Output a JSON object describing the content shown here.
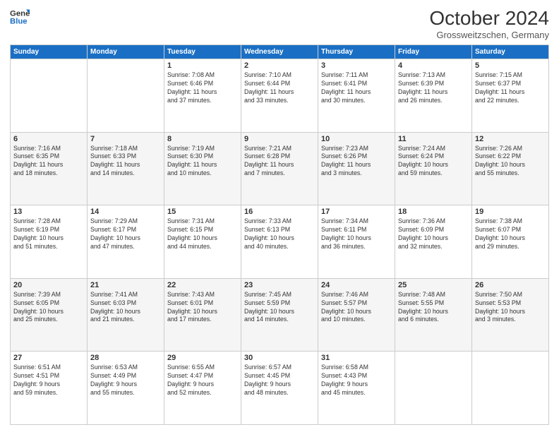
{
  "header": {
    "logo_line1": "General",
    "logo_line2": "Blue",
    "title": "October 2024",
    "subtitle": "Grossweitzschen, Germany"
  },
  "days_of_week": [
    "Sunday",
    "Monday",
    "Tuesday",
    "Wednesday",
    "Thursday",
    "Friday",
    "Saturday"
  ],
  "weeks": [
    [
      {
        "day": "",
        "info": ""
      },
      {
        "day": "",
        "info": ""
      },
      {
        "day": "1",
        "info": "Sunrise: 7:08 AM\nSunset: 6:46 PM\nDaylight: 11 hours\nand 37 minutes."
      },
      {
        "day": "2",
        "info": "Sunrise: 7:10 AM\nSunset: 6:44 PM\nDaylight: 11 hours\nand 33 minutes."
      },
      {
        "day": "3",
        "info": "Sunrise: 7:11 AM\nSunset: 6:41 PM\nDaylight: 11 hours\nand 30 minutes."
      },
      {
        "day": "4",
        "info": "Sunrise: 7:13 AM\nSunset: 6:39 PM\nDaylight: 11 hours\nand 26 minutes."
      },
      {
        "day": "5",
        "info": "Sunrise: 7:15 AM\nSunset: 6:37 PM\nDaylight: 11 hours\nand 22 minutes."
      }
    ],
    [
      {
        "day": "6",
        "info": "Sunrise: 7:16 AM\nSunset: 6:35 PM\nDaylight: 11 hours\nand 18 minutes."
      },
      {
        "day": "7",
        "info": "Sunrise: 7:18 AM\nSunset: 6:33 PM\nDaylight: 11 hours\nand 14 minutes."
      },
      {
        "day": "8",
        "info": "Sunrise: 7:19 AM\nSunset: 6:30 PM\nDaylight: 11 hours\nand 10 minutes."
      },
      {
        "day": "9",
        "info": "Sunrise: 7:21 AM\nSunset: 6:28 PM\nDaylight: 11 hours\nand 7 minutes."
      },
      {
        "day": "10",
        "info": "Sunrise: 7:23 AM\nSunset: 6:26 PM\nDaylight: 11 hours\nand 3 minutes."
      },
      {
        "day": "11",
        "info": "Sunrise: 7:24 AM\nSunset: 6:24 PM\nDaylight: 10 hours\nand 59 minutes."
      },
      {
        "day": "12",
        "info": "Sunrise: 7:26 AM\nSunset: 6:22 PM\nDaylight: 10 hours\nand 55 minutes."
      }
    ],
    [
      {
        "day": "13",
        "info": "Sunrise: 7:28 AM\nSunset: 6:19 PM\nDaylight: 10 hours\nand 51 minutes."
      },
      {
        "day": "14",
        "info": "Sunrise: 7:29 AM\nSunset: 6:17 PM\nDaylight: 10 hours\nand 47 minutes."
      },
      {
        "day": "15",
        "info": "Sunrise: 7:31 AM\nSunset: 6:15 PM\nDaylight: 10 hours\nand 44 minutes."
      },
      {
        "day": "16",
        "info": "Sunrise: 7:33 AM\nSunset: 6:13 PM\nDaylight: 10 hours\nand 40 minutes."
      },
      {
        "day": "17",
        "info": "Sunrise: 7:34 AM\nSunset: 6:11 PM\nDaylight: 10 hours\nand 36 minutes."
      },
      {
        "day": "18",
        "info": "Sunrise: 7:36 AM\nSunset: 6:09 PM\nDaylight: 10 hours\nand 32 minutes."
      },
      {
        "day": "19",
        "info": "Sunrise: 7:38 AM\nSunset: 6:07 PM\nDaylight: 10 hours\nand 29 minutes."
      }
    ],
    [
      {
        "day": "20",
        "info": "Sunrise: 7:39 AM\nSunset: 6:05 PM\nDaylight: 10 hours\nand 25 minutes."
      },
      {
        "day": "21",
        "info": "Sunrise: 7:41 AM\nSunset: 6:03 PM\nDaylight: 10 hours\nand 21 minutes."
      },
      {
        "day": "22",
        "info": "Sunrise: 7:43 AM\nSunset: 6:01 PM\nDaylight: 10 hours\nand 17 minutes."
      },
      {
        "day": "23",
        "info": "Sunrise: 7:45 AM\nSunset: 5:59 PM\nDaylight: 10 hours\nand 14 minutes."
      },
      {
        "day": "24",
        "info": "Sunrise: 7:46 AM\nSunset: 5:57 PM\nDaylight: 10 hours\nand 10 minutes."
      },
      {
        "day": "25",
        "info": "Sunrise: 7:48 AM\nSunset: 5:55 PM\nDaylight: 10 hours\nand 6 minutes."
      },
      {
        "day": "26",
        "info": "Sunrise: 7:50 AM\nSunset: 5:53 PM\nDaylight: 10 hours\nand 3 minutes."
      }
    ],
    [
      {
        "day": "27",
        "info": "Sunrise: 6:51 AM\nSunset: 4:51 PM\nDaylight: 9 hours\nand 59 minutes."
      },
      {
        "day": "28",
        "info": "Sunrise: 6:53 AM\nSunset: 4:49 PM\nDaylight: 9 hours\nand 55 minutes."
      },
      {
        "day": "29",
        "info": "Sunrise: 6:55 AM\nSunset: 4:47 PM\nDaylight: 9 hours\nand 52 minutes."
      },
      {
        "day": "30",
        "info": "Sunrise: 6:57 AM\nSunset: 4:45 PM\nDaylight: 9 hours\nand 48 minutes."
      },
      {
        "day": "31",
        "info": "Sunrise: 6:58 AM\nSunset: 4:43 PM\nDaylight: 9 hours\nand 45 minutes."
      },
      {
        "day": "",
        "info": ""
      },
      {
        "day": "",
        "info": ""
      }
    ]
  ]
}
